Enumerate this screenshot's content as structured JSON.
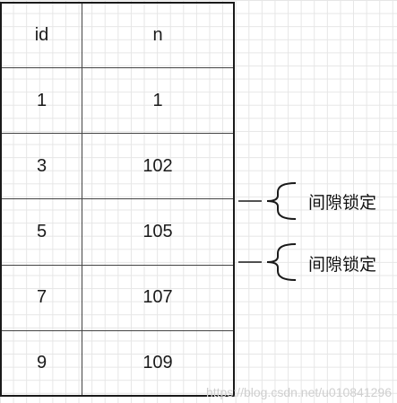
{
  "table": {
    "headers": [
      "id",
      "n"
    ],
    "rows": [
      [
        "1",
        "1"
      ],
      [
        "3",
        "102"
      ],
      [
        "5",
        "105"
      ],
      [
        "7",
        "107"
      ],
      [
        "9",
        "109"
      ]
    ]
  },
  "annotations": [
    {
      "label": "间隙锁定"
    },
    {
      "label": "间隙锁定"
    }
  ],
  "watermark": "https://blog.csdn.net/u010841296",
  "colors": {
    "line": "#1a1a1a",
    "grid": "#e6e6e6"
  }
}
